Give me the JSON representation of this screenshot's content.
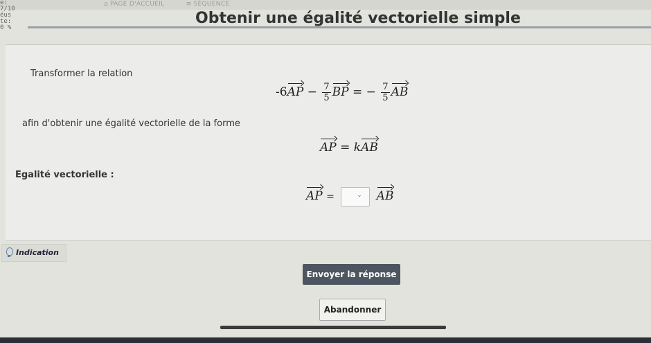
{
  "breadcrumb": {
    "home": "PAGE D'ACCUEIL",
    "section": "SÉQUENCE"
  },
  "side_fragments": [
    "e:",
    "7/10",
    "éus",
    "te:",
    "0 %"
  ],
  "page": {
    "title": "Obtenir une égalité vectorielle simple"
  },
  "exercise": {
    "intro": "Transformer la relation",
    "relation": {
      "coef1": "-6",
      "v1": "AP",
      "op": "−",
      "frac1_num": "7",
      "frac1_den": "5",
      "v2": "BP",
      "eq": "= −",
      "frac2_num": "7",
      "frac2_den": "5",
      "v3": "AB"
    },
    "goal_text": "afin d'obtenir une égalité vectorielle de la forme",
    "target": {
      "lhs": "AP",
      "eq": "=",
      "k": "k",
      "rhs": "AB"
    },
    "answer_label": "Egalité vectorielle :",
    "answer": {
      "lhs": "AP",
      "eq": "=",
      "selected": "",
      "rhs": "AB"
    }
  },
  "hint": {
    "label": "Indication"
  },
  "actions": {
    "submit_label": "Envoyer la réponse",
    "cancel_label": "Abandonner"
  },
  "colors": {
    "background": "#e3e3de",
    "submit_bg": "#4d5560",
    "hint_icon": "#5a80b8"
  }
}
